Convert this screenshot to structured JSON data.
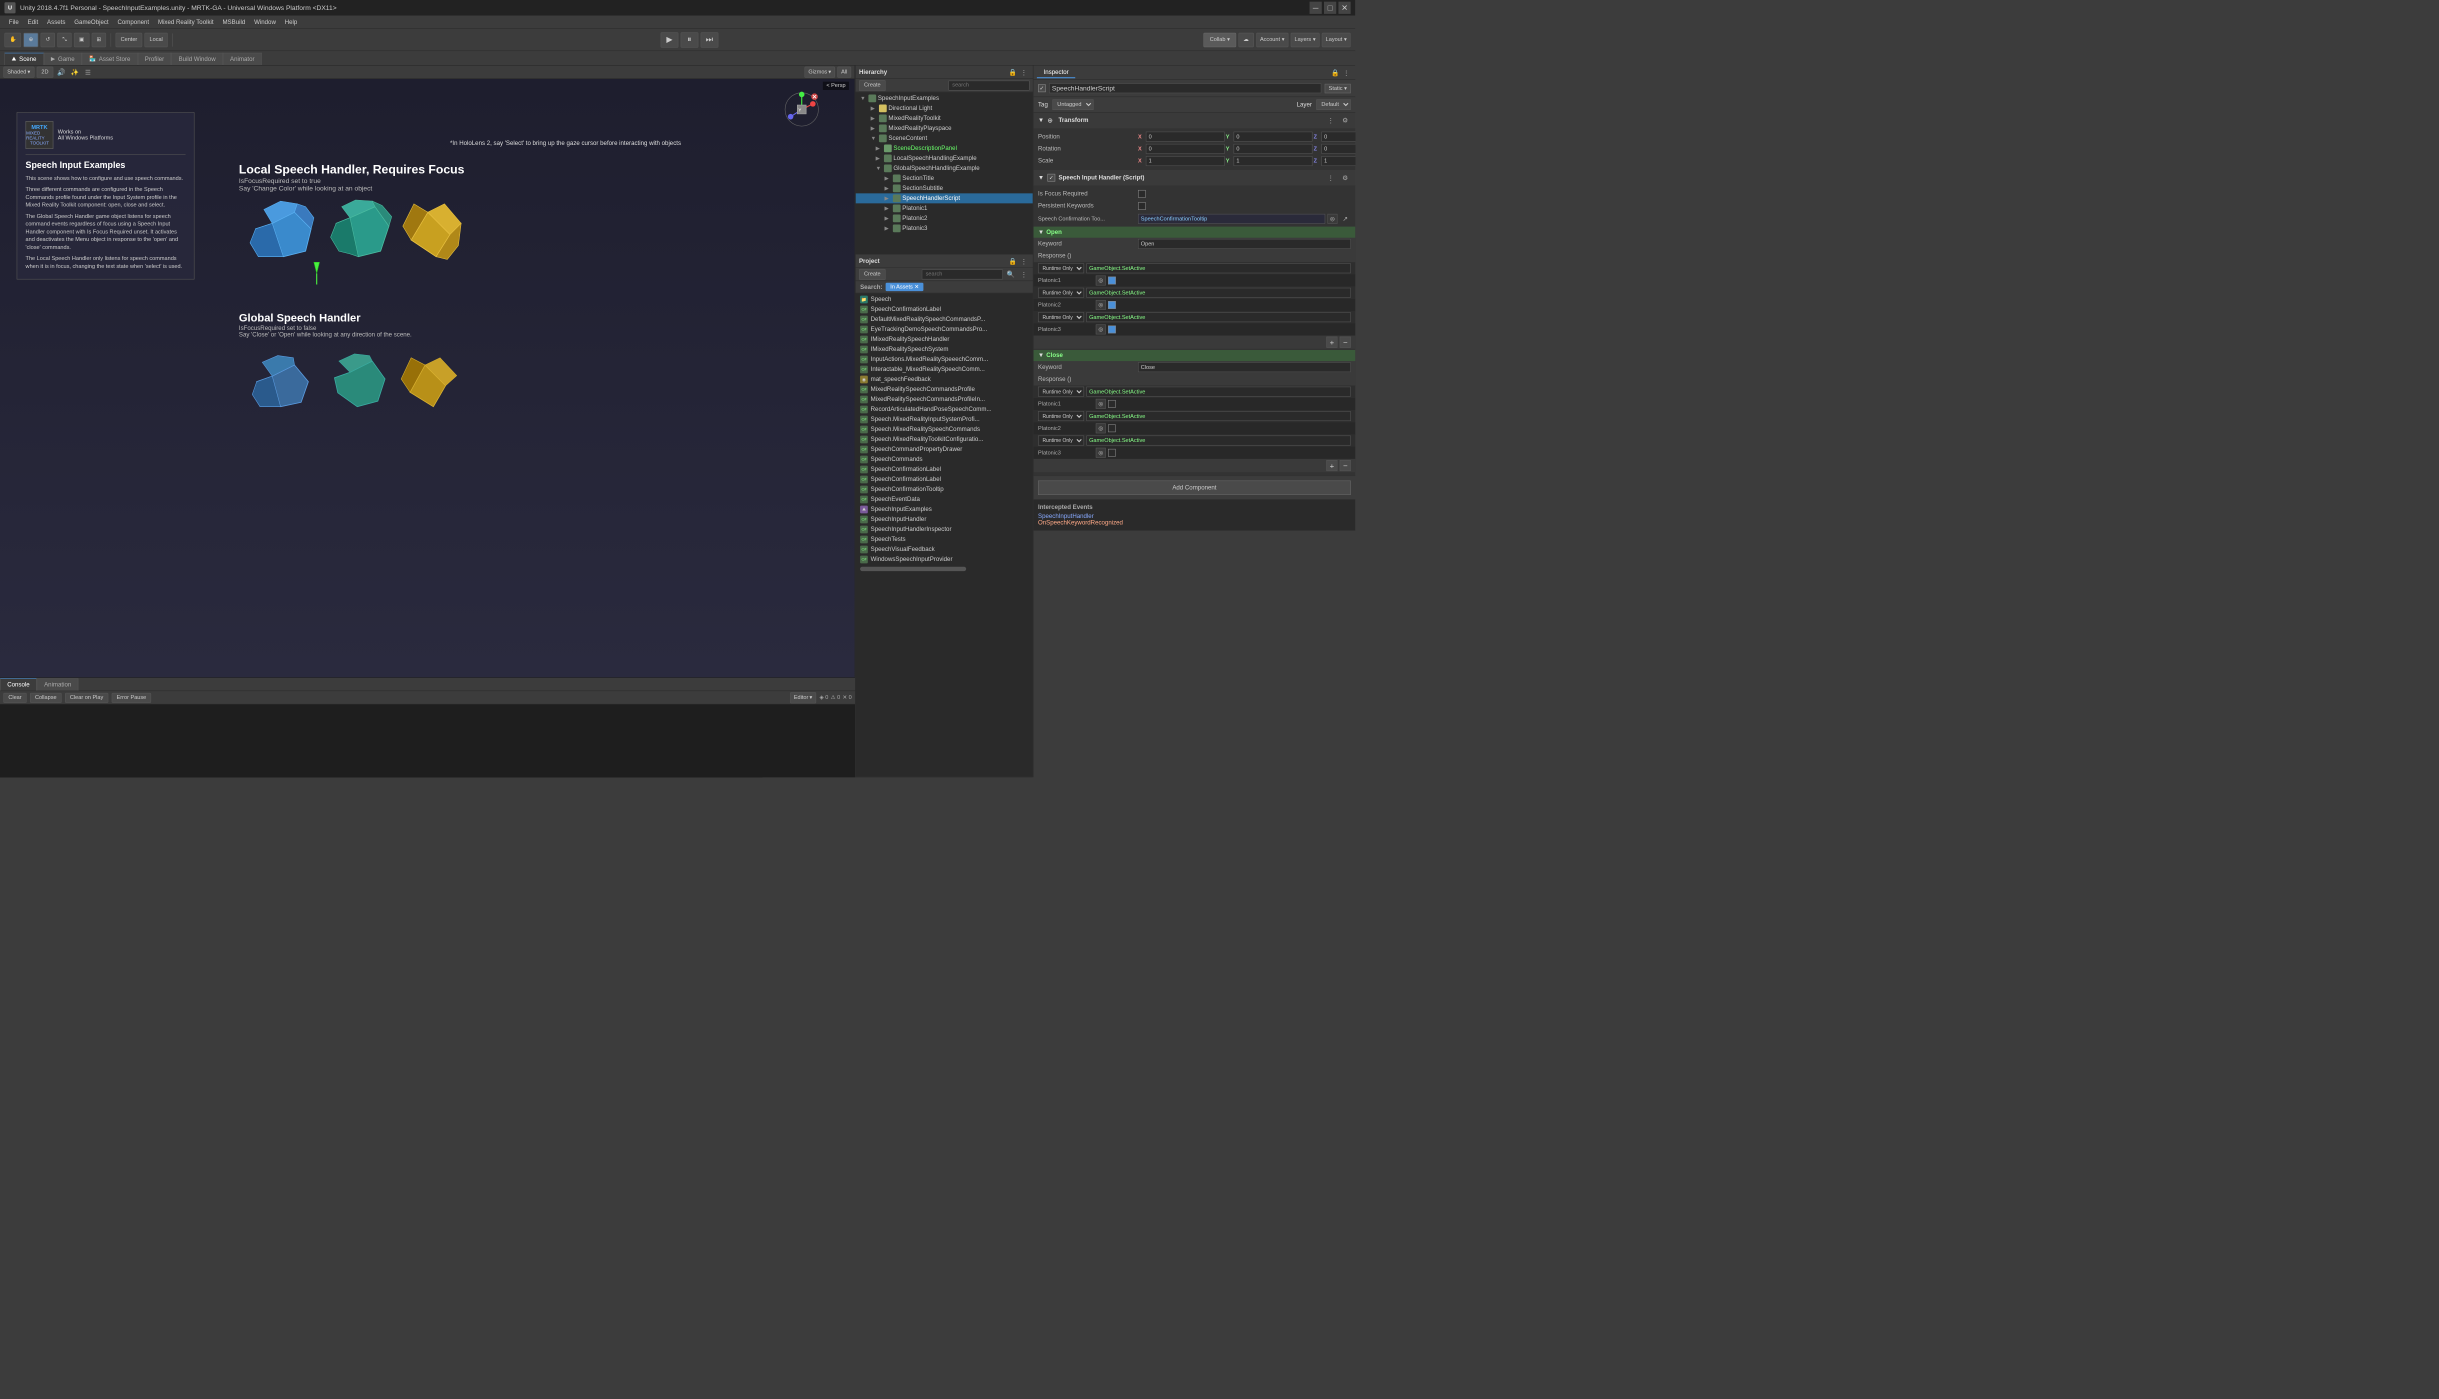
{
  "window": {
    "title": "Unity 2018.4.7f1 Personal - SpeechInputExamples.unity - MRTK-GA - Universal Windows Platform <DX11>"
  },
  "menu": {
    "items": [
      "File",
      "Edit",
      "Assets",
      "GameObject",
      "Component",
      "Mixed Reality Toolkit",
      "MSBuild",
      "Window",
      "Help"
    ]
  },
  "toolbar": {
    "tools": [
      "hand_icon",
      "move_icon",
      "rotate_icon",
      "scale_icon",
      "rect_icon",
      "transform_icon"
    ],
    "pivot_label": "Center",
    "space_label": "Local",
    "play_icon": "▶",
    "pause_icon": "⏸",
    "step_icon": "⏭",
    "collab_label": "Collab",
    "account_label": "Account",
    "layers_label": "Layers",
    "layout_label": "Layout"
  },
  "tabs": {
    "scene_label": "Scene",
    "game_label": "Game",
    "asset_store_label": "Asset Store",
    "profiler_label": "Profiler",
    "build_window_label": "Build Window",
    "animator_label": "Animator"
  },
  "scene": {
    "shaded_label": "Shaded",
    "twod_label": "2D",
    "gizmos_label": "Gizmos",
    "all_label": "All",
    "persp_label": "< Persp",
    "info_title": "*In HoloLens 2, say 'Select' to bring up the gaze cursor before interacting with objects",
    "local_handler_title": "Local Speech Handler, Requires Focus",
    "focus_required": "IsFocusRequired set to true",
    "say_change": "Say 'Change Color' while looking at an object",
    "global_handler_title": "Global Speech Handler",
    "global_focus": "IsFocusRequired set to false",
    "global_say": "Say 'Close' or 'Open' while looking at any direction of the scene."
  },
  "info_panel": {
    "works_on": "Works on",
    "all_windows": "All Windows Platforms",
    "title": "Speech Input Examples",
    "description1": "This scene shows how to configure and use speech commands.",
    "description2": "Three different commands are configured in the Speech Commands profile found under the Input System profile in the Mixed Reality Toolkit component: open, close and select.",
    "description3": "The Global Speech Handler game object listens for speech command events regardless of focus using a Speech Input Handler component with Is Focus Required unset. It activates and deactivates the Menu object in response to the 'open' and 'close' commands.",
    "description4": "The Local Speech Handler only listens for speech commands when it is in focus, changing the text state when 'select' is used."
  },
  "console": {
    "tab_label": "Console",
    "animation_label": "Animation",
    "clear_label": "Clear",
    "collapse_label": "Collapse",
    "clear_on_play": "Clear on Play",
    "error_pause": "Error Pause",
    "editor_label": "Editor"
  },
  "hierarchy": {
    "title": "Hierarchy",
    "create_label": "Create",
    "items": [
      {
        "name": "SpeechInputExamples",
        "level": 0,
        "expanded": true,
        "icon": "scene"
      },
      {
        "name": "Directional Light",
        "level": 1,
        "expanded": false,
        "icon": "light"
      },
      {
        "name": "MixedRealityToolkit",
        "level": 1,
        "expanded": false,
        "icon": "obj"
      },
      {
        "name": "MixedRealityPlayspace",
        "level": 1,
        "expanded": false,
        "icon": "obj"
      },
      {
        "name": "SceneContent",
        "level": 1,
        "expanded": true,
        "icon": "obj"
      },
      {
        "name": "SceneDescriptionPanel",
        "level": 2,
        "expanded": false,
        "icon": "obj",
        "active": true
      },
      {
        "name": "LocalSpeechHandlingExample",
        "level": 2,
        "expanded": false,
        "icon": "obj"
      },
      {
        "name": "GlobalSpeechHandlingExample",
        "level": 2,
        "expanded": true,
        "icon": "obj"
      },
      {
        "name": "SectionTitle",
        "level": 3,
        "expanded": false,
        "icon": "obj"
      },
      {
        "name": "SectionSubtitle",
        "level": 3,
        "expanded": false,
        "icon": "obj"
      },
      {
        "name": "SpeechHandlerScript",
        "level": 3,
        "expanded": false,
        "icon": "obj",
        "selected": true
      }
    ]
  },
  "hierarchy2": {
    "items": [
      {
        "name": "Platonic1",
        "level": 3
      },
      {
        "name": "Platonic2",
        "level": 3
      },
      {
        "name": "Platonic3",
        "level": 3
      }
    ]
  },
  "project": {
    "title": "Project",
    "search_placeholder": "search",
    "search_label": "Search:",
    "in_assets_label": "In Assets",
    "items": [
      {
        "name": "Speech",
        "icon": "folder"
      },
      {
        "name": "SpeechConfirmationLabel",
        "icon": "script"
      },
      {
        "name": "DefaultMixedRealitySpeechCommandsP...",
        "icon": "script"
      },
      {
        "name": "EyeTrackingDemoSpeechCommandsPro...",
        "icon": "script"
      },
      {
        "name": "IMixedRealitySpeechHandler",
        "icon": "script"
      },
      {
        "name": "IMixedRealitySpeechSystem",
        "icon": "script"
      },
      {
        "name": "InputActions.MixedRealitySpeeechComm...",
        "icon": "script"
      },
      {
        "name": "Interactable_MixedRealitySpeechComm...",
        "icon": "script"
      },
      {
        "name": "mat_speechFeedback",
        "icon": "material"
      },
      {
        "name": "MixedRealitySpeechCommandsProfile",
        "icon": "script"
      },
      {
        "name": "MixedRealitySpeechCommandsProfileIn...",
        "icon": "script"
      },
      {
        "name": "RecordArticulatedHandPoseSpeechComm...",
        "icon": "script"
      },
      {
        "name": "Speech.MixedRealityInputSystemProfi...",
        "icon": "script"
      },
      {
        "name": "Speech.MixedRealitySpeechCommands",
        "icon": "script"
      },
      {
        "name": "Speech.MixedRealityToolkitConfiguratio...",
        "icon": "script"
      },
      {
        "name": "SpeechCommandPropertyDrawer",
        "icon": "script"
      },
      {
        "name": "SpeechCommands",
        "icon": "script"
      },
      {
        "name": "SpeechConfirmationLabel",
        "icon": "script"
      },
      {
        "name": "SpeechConfirmationLabel",
        "icon": "script"
      },
      {
        "name": "SpeechConfirmationTooltip",
        "icon": "script"
      },
      {
        "name": "SpeechEventData",
        "icon": "script"
      },
      {
        "name": "SpeechInputExamples",
        "icon": "scene"
      },
      {
        "name": "SpeechInputHandler",
        "icon": "script"
      },
      {
        "name": "SpeechInputHandlerInspector",
        "icon": "script"
      },
      {
        "name": "SpeechTests",
        "icon": "script"
      },
      {
        "name": "SpeechVisualFeedback",
        "icon": "script"
      },
      {
        "name": "WindowsSpeechInputProvider",
        "icon": "script"
      }
    ]
  },
  "inspector": {
    "title": "Inspector",
    "tab_label": "Inspector",
    "object_name": "SpeechHandlerScript",
    "static_label": "Static",
    "tag_label": "Tag",
    "tag_value": "Untagged",
    "layer_label": "Layer",
    "layer_value": "Default",
    "transform": {
      "title": "Transform",
      "position_label": "Position",
      "rotation_label": "Rotation",
      "scale_label": "Scale",
      "pos_x": "0",
      "pos_y": "0",
      "pos_z": "0",
      "rot_x": "0",
      "rot_y": "0",
      "rot_z": "0",
      "scale_x": "1",
      "scale_y": "1",
      "scale_z": "1"
    },
    "speech_handler": {
      "title": "Speech Input Handler (Script)",
      "is_focus_required_label": "Is Focus Required",
      "persistent_keywords_label": "Persistent Keywords",
      "speech_confirmation_label": "Speech Confirmation Too...",
      "speech_confirmation_value": "SpeechConfirmationTooltip",
      "open_section": {
        "label": "Open",
        "keyword_label": "Keyword",
        "keyword_value": "Open",
        "response_label": "Response ()",
        "rows": [
          {
            "runtime": "Runtime Only",
            "method": "GameObject.SetActive",
            "target": "Platonic1",
            "checked": true
          },
          {
            "runtime": "Runtime Only",
            "method": "GameObject.SetActive",
            "target": "Platonic2",
            "checked": true
          },
          {
            "runtime": "Runtime Only",
            "method": "GameObject.SetActive",
            "target": "Platonic3",
            "checked": true
          }
        ]
      },
      "close_section": {
        "label": "Close",
        "keyword_label": "Keyword",
        "keyword_value": "Close",
        "response_label": "Response ()",
        "rows": [
          {
            "runtime": "Runtime Only",
            "method": "GameObject.SetActive",
            "target": "Platonic1",
            "checked": false
          },
          {
            "runtime": "Runtime Only",
            "method": "GameObject.SetActive",
            "target": "Platonic2",
            "checked": false
          },
          {
            "runtime": "Runtime Only",
            "method": "GameObject.SetActive",
            "target": "Platonic3",
            "checked": false
          }
        ]
      }
    },
    "add_component_label": "Add Component",
    "intercepted_events": {
      "title": "Intercepted Events",
      "handler": "SpeechInputHandler",
      "method": "OnSpeechKeywordRecognized"
    }
  },
  "colors": {
    "accent_blue": "#4a90d9",
    "unity_dark": "#3c3c3c",
    "panel_dark": "#2a2a2a",
    "selected": "#3a5a9a",
    "green": "#8aff8a"
  }
}
